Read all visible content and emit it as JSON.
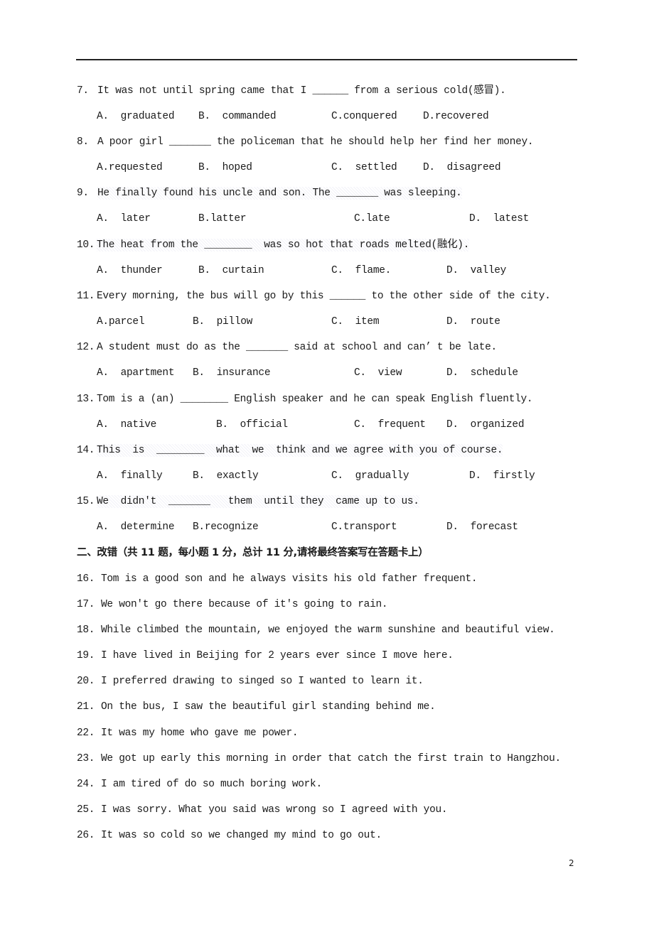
{
  "page": {
    "page_number": "2"
  },
  "choice_questions": [
    {
      "num": "7.",
      "before": "It was not until spring came that I ",
      "blank": "______",
      "after": " from a serious cold(感冒).",
      "options": [
        {
          "label": "A.",
          "text": "graduated"
        },
        {
          "label": "B.",
          "text": "commanded"
        },
        {
          "label": "C.",
          "text": "conquered"
        },
        {
          "label": "D.",
          "text": "recovered"
        }
      ]
    },
    {
      "num": "8.",
      "before": "A poor girl ",
      "blank": "_______",
      "after": " the policeman that he should help her find her money.",
      "options": [
        {
          "label": "A.",
          "text": "requested"
        },
        {
          "label": "B.",
          "text": "hoped"
        },
        {
          "label": "C.",
          "text": "settled"
        },
        {
          "label": "D.",
          "text": "disagreed"
        }
      ]
    },
    {
      "num": "9.",
      "before": "He finally found his uncle and son. The ",
      "blank": "_______",
      "after": " was sleeping.",
      "options": [
        {
          "label": "A.",
          "text": "later"
        },
        {
          "label": "B.",
          "text": "latter"
        },
        {
          "label": "C.",
          "text": "late"
        },
        {
          "label": "D.",
          "text": "latest"
        }
      ]
    },
    {
      "num": "10.",
      "before": "The heat from the ",
      "blank": "________",
      "after": "  was so hot that roads melted(融化).",
      "options": [
        {
          "label": "A.",
          "text": "thunder"
        },
        {
          "label": "B.",
          "text": "curtain"
        },
        {
          "label": "C.",
          "text": "flame."
        },
        {
          "label": "D.",
          "text": "valley"
        }
      ]
    },
    {
      "num": "11.",
      "before": "Every morning, the bus will go by this ",
      "blank": "______",
      "after": " to the other side of the city.",
      "options": [
        {
          "label": "A.",
          "text": "parcel"
        },
        {
          "label": "B.",
          "text": "pillow"
        },
        {
          "label": "C.",
          "text": "item"
        },
        {
          "label": "D.",
          "text": "route"
        }
      ]
    },
    {
      "num": "12.",
      "before": "A student must do as the ",
      "blank": "_______",
      "after": " said at school and can’ t be late.",
      "options": [
        {
          "label": "A.",
          "text": "apartment"
        },
        {
          "label": "B.",
          "text": "insurance"
        },
        {
          "label": "C.",
          "text": "view"
        },
        {
          "label": "D.",
          "text": "schedule"
        }
      ]
    },
    {
      "num": "13.",
      "before": "Tom is a (an) ",
      "blank": "________",
      "after": " English speaker and he can speak English fluently.",
      "options": [
        {
          "label": "A.",
          "text": "native"
        },
        {
          "label": "B.",
          "text": "official"
        },
        {
          "label": "C.",
          "text": "frequent"
        },
        {
          "label": "D.",
          "text": "organized"
        }
      ]
    },
    {
      "num": "14.",
      "before": "This  is  ",
      "blank": "________",
      "after": "  what  we  think and we agree with you of course.",
      "options": [
        {
          "label": "A.",
          "text": "finally"
        },
        {
          "label": "B.",
          "text": "exactly"
        },
        {
          "label": "C.",
          "text": "gradually"
        },
        {
          "label": "D.",
          "text": "firstly"
        }
      ]
    },
    {
      "num": "15.",
      "before": "We  didn't  ",
      "blank": "_______",
      "after": "   them  until they  came up to us.",
      "options": [
        {
          "label": "A.",
          "text": "determine"
        },
        {
          "label": "B.",
          "text": "recognize"
        },
        {
          "label": "C.",
          "text": "transport"
        },
        {
          "label": "D.",
          "text": "forecast"
        }
      ]
    }
  ],
  "section_two": {
    "heading": "二、改错（共 11 题，每小题 1 分，总计 11 分,请将最终答案写在答题卡上）"
  },
  "correction_questions": [
    {
      "num": "16.",
      "text": "Tom is a good son and he always visits his old father frequent."
    },
    {
      "num": "17.",
      "text": "We won't go there because of it's going to rain."
    },
    {
      "num": "18.",
      "text": "While climbed the mountain, we enjoyed the warm sunshine and beautiful view."
    },
    {
      "num": "19.",
      "text": "I have lived in Beijing for 2 years ever since I move here."
    },
    {
      "num": "20.",
      "text": "I preferred drawing to singed so I wanted to learn it."
    },
    {
      "num": "21.",
      "text": "On the bus, I saw the beautiful girl standing behind me."
    },
    {
      "num": "22.",
      "text": "It was my home who gave me power."
    },
    {
      "num": "23.",
      "text": "We got up early this morning in order that catch the first train to Hangzhou."
    },
    {
      "num": "24.",
      "text": "I am tired of do so much boring work."
    },
    {
      "num": "25.",
      "text": "I was sorry. What you said was wrong so I agreed with you."
    },
    {
      "num": "26.",
      "text": "It was so cold so we changed my mind to go out."
    }
  ]
}
